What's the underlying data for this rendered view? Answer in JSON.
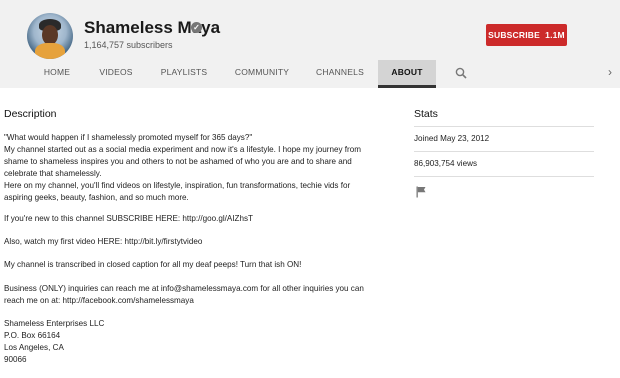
{
  "channel": {
    "name": "Shameless Maya",
    "subscribers": "1,164,757 subscribers"
  },
  "subscribe": {
    "label": "SUBSCRIBE",
    "count": "1.1M"
  },
  "tabs": [
    {
      "label": "HOME"
    },
    {
      "label": "VIDEOS"
    },
    {
      "label": "PLAYLISTS"
    },
    {
      "label": "COMMUNITY"
    },
    {
      "label": "CHANNELS"
    },
    {
      "label": "ABOUT",
      "active": true
    }
  ],
  "description": {
    "title": "Description",
    "lines": [
      "\"What would happen if I shamelessly promoted myself for 365 days?\"",
      "My channel started out as a social media experiment and now it's a lifestyle. I hope my journey from",
      "shame to shameless inspires you and others to not be ashamed of who you are and to share and",
      "celebrate that shamelessly.",
      "Here on my channel, you'll find videos on lifestyle, inspiration, fun transformations, techie vids for",
      "aspiring geeks, beauty, fashion, and so much more.",
      "If you're new to this channel SUBSCRIBE HERE: http://goo.gl/AIZhsT",
      "Also, watch my first video HERE: http://bit.ly/firstytvideo",
      "My channel is transcribed in closed caption for all my deaf peeps! Turn that ish ON!",
      "Business (ONLY) inquiries can reach me at info@shamelessmaya.com for all other inquiries you can",
      "reach me on at: http://facebook.com/shamelessmaya",
      "Shameless Enterprises LLC",
      "P.O. Box 66164",
      "Los Angeles, CA",
      "90066"
    ]
  },
  "stats": {
    "title": "Stats",
    "joined": "Joined May 23, 2012",
    "views": "86,903,754 views"
  },
  "icons": {
    "verified": "verified-check-icon",
    "search": "search-icon",
    "next": "chevron-right-icon",
    "report": "flag-icon"
  },
  "colors": {
    "subscribe": "#cc2a2a",
    "header_bg": "#f1f1f1",
    "active_tab_bg": "#d4d4d4"
  }
}
